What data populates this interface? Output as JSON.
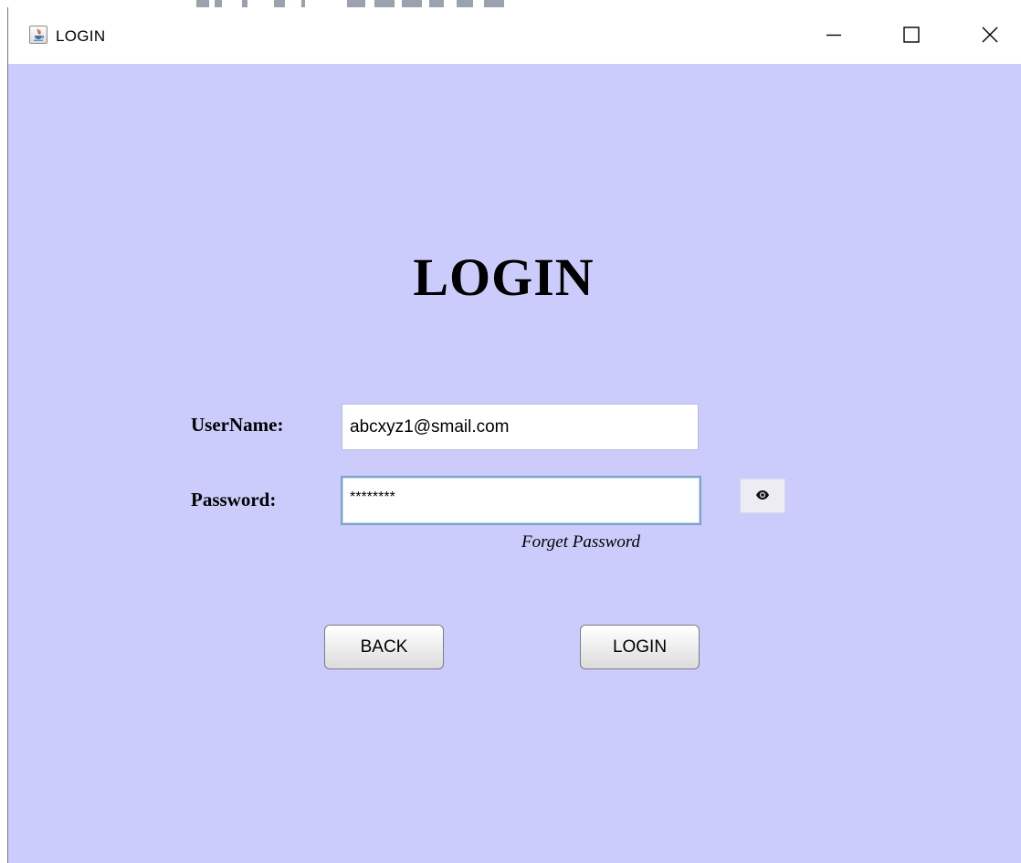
{
  "window": {
    "title": "LOGIN",
    "controls": {
      "minimize_icon": "minimize-icon",
      "maximize_icon": "maximize-icon",
      "close_icon": "close-icon"
    }
  },
  "form": {
    "heading": "LOGIN",
    "username": {
      "label": "UserName:",
      "value": "abcxyz1@smail.com"
    },
    "password": {
      "label": "Password:",
      "value": "********",
      "toggle_icon": "eye-icon"
    },
    "forget_password": "Forget Password",
    "buttons": {
      "back": "BACK",
      "login": "LOGIN"
    }
  },
  "colors": {
    "background": "#ccccfc",
    "field_focus_border": "#7aa3c9"
  }
}
